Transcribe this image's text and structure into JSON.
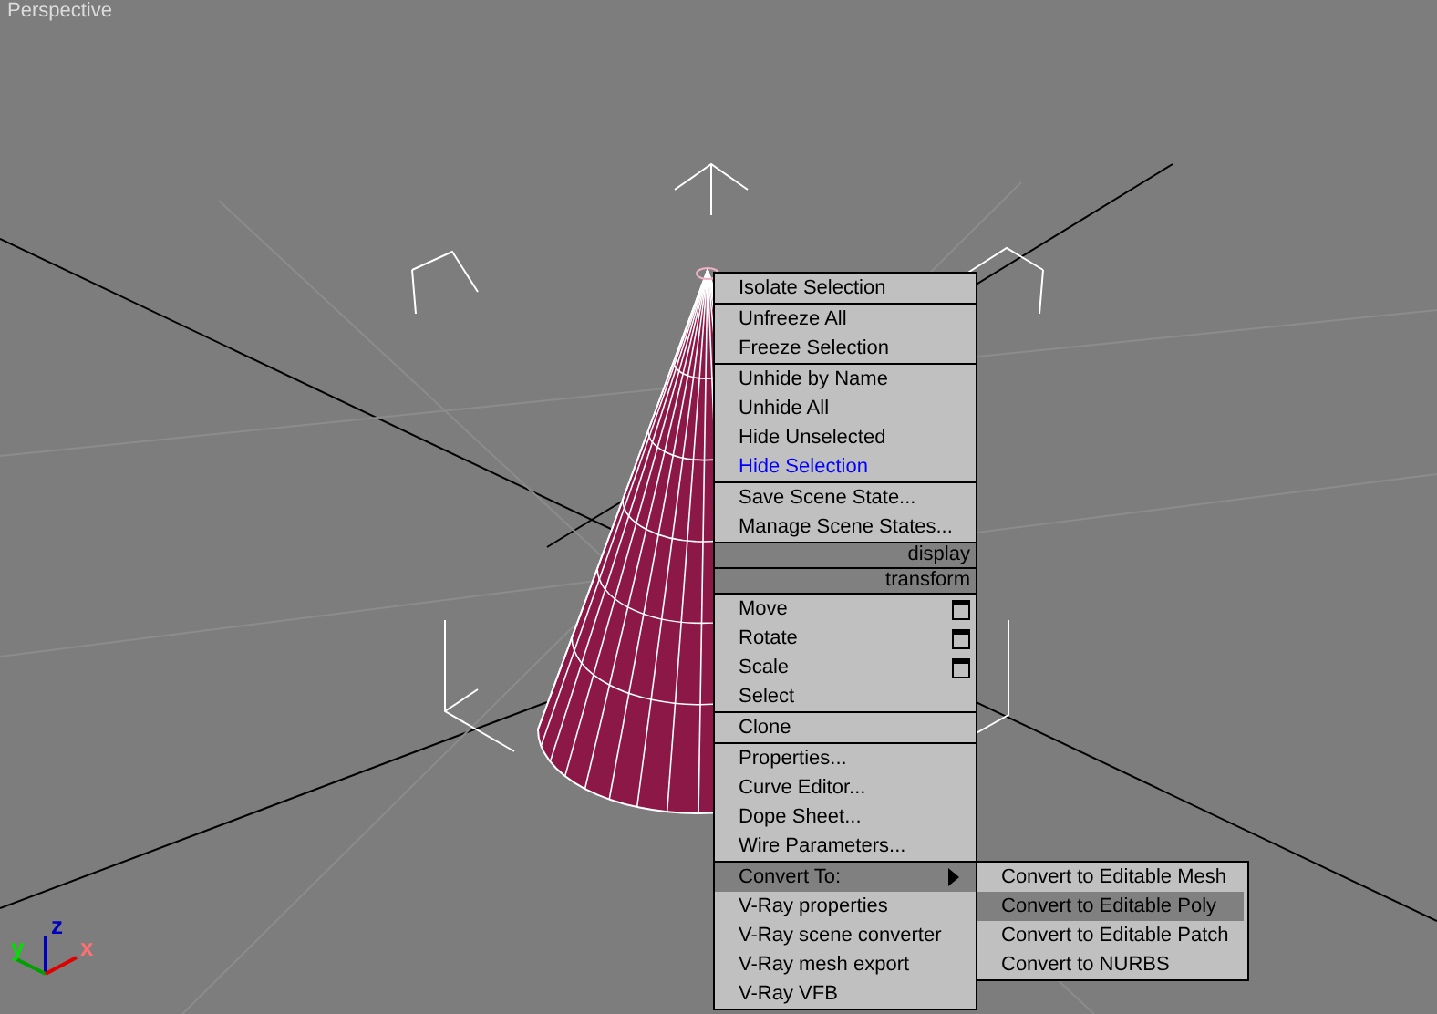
{
  "viewport": {
    "label": "Perspective",
    "axes": [
      {
        "kind": "z",
        "label": "z"
      },
      {
        "kind": "y",
        "label": "y"
      },
      {
        "kind": "x",
        "label": "x"
      }
    ]
  },
  "quad_menu": {
    "groups": [
      {
        "kind": "items",
        "items": [
          {
            "label": "Isolate Selection",
            "highlighted": false,
            "options": false,
            "submenu": false,
            "selected": false
          }
        ]
      },
      {
        "kind": "items",
        "items": [
          {
            "label": "Unfreeze All",
            "highlighted": false,
            "options": false,
            "submenu": false,
            "selected": false
          },
          {
            "label": "Freeze Selection",
            "highlighted": false,
            "options": false,
            "submenu": false,
            "selected": false
          }
        ]
      },
      {
        "kind": "items",
        "items": [
          {
            "label": "Unhide by Name",
            "highlighted": false,
            "options": false,
            "submenu": false,
            "selected": false
          },
          {
            "label": "Unhide All",
            "highlighted": false,
            "options": false,
            "submenu": false,
            "selected": false
          },
          {
            "label": "Hide Unselected",
            "highlighted": false,
            "options": false,
            "submenu": false,
            "selected": false
          },
          {
            "label": "Hide Selection",
            "highlighted": true,
            "options": false,
            "submenu": false,
            "selected": false
          }
        ]
      },
      {
        "kind": "items",
        "items": [
          {
            "label": "Save Scene State...",
            "highlighted": false,
            "options": false,
            "submenu": false,
            "selected": false
          },
          {
            "label": "Manage Scene States...",
            "highlighted": false,
            "options": false,
            "submenu": false,
            "selected": false
          }
        ]
      },
      {
        "kind": "header",
        "label": "display"
      },
      {
        "kind": "header",
        "label": "transform"
      },
      {
        "kind": "items",
        "items": [
          {
            "label": "Move",
            "highlighted": false,
            "options": true,
            "submenu": false,
            "selected": false
          },
          {
            "label": "Rotate",
            "highlighted": false,
            "options": true,
            "submenu": false,
            "selected": false
          },
          {
            "label": "Scale",
            "highlighted": false,
            "options": true,
            "submenu": false,
            "selected": false
          },
          {
            "label": "Select",
            "highlighted": false,
            "options": false,
            "submenu": false,
            "selected": false
          }
        ]
      },
      {
        "kind": "items",
        "items": [
          {
            "label": "Clone",
            "highlighted": false,
            "options": false,
            "submenu": false,
            "selected": false
          }
        ]
      },
      {
        "kind": "items",
        "items": [
          {
            "label": "Properties...",
            "highlighted": false,
            "options": false,
            "submenu": false,
            "selected": false
          },
          {
            "label": "Curve Editor...",
            "highlighted": false,
            "options": false,
            "submenu": false,
            "selected": false
          },
          {
            "label": "Dope Sheet...",
            "highlighted": false,
            "options": false,
            "submenu": false,
            "selected": false
          },
          {
            "label": "Wire Parameters...",
            "highlighted": false,
            "options": false,
            "submenu": false,
            "selected": false
          }
        ]
      },
      {
        "kind": "items",
        "items": [
          {
            "label": "Convert To:",
            "highlighted": false,
            "options": false,
            "submenu": true,
            "selected": true
          },
          {
            "label": "V-Ray properties",
            "highlighted": false,
            "options": false,
            "submenu": false,
            "selected": false
          },
          {
            "label": "V-Ray scene converter",
            "highlighted": false,
            "options": false,
            "submenu": false,
            "selected": false
          },
          {
            "label": "V-Ray mesh export",
            "highlighted": false,
            "options": false,
            "submenu": false,
            "selected": false
          },
          {
            "label": "V-Ray VFB",
            "highlighted": false,
            "options": false,
            "submenu": false,
            "selected": false
          }
        ]
      }
    ]
  },
  "submenu": {
    "items": [
      {
        "label": "Convert to Editable Mesh",
        "selected": false
      },
      {
        "label": "Convert to Editable Poly",
        "selected": true
      },
      {
        "label": "Convert to Editable Patch",
        "selected": false
      },
      {
        "label": "Convert to NURBS",
        "selected": false
      }
    ]
  }
}
